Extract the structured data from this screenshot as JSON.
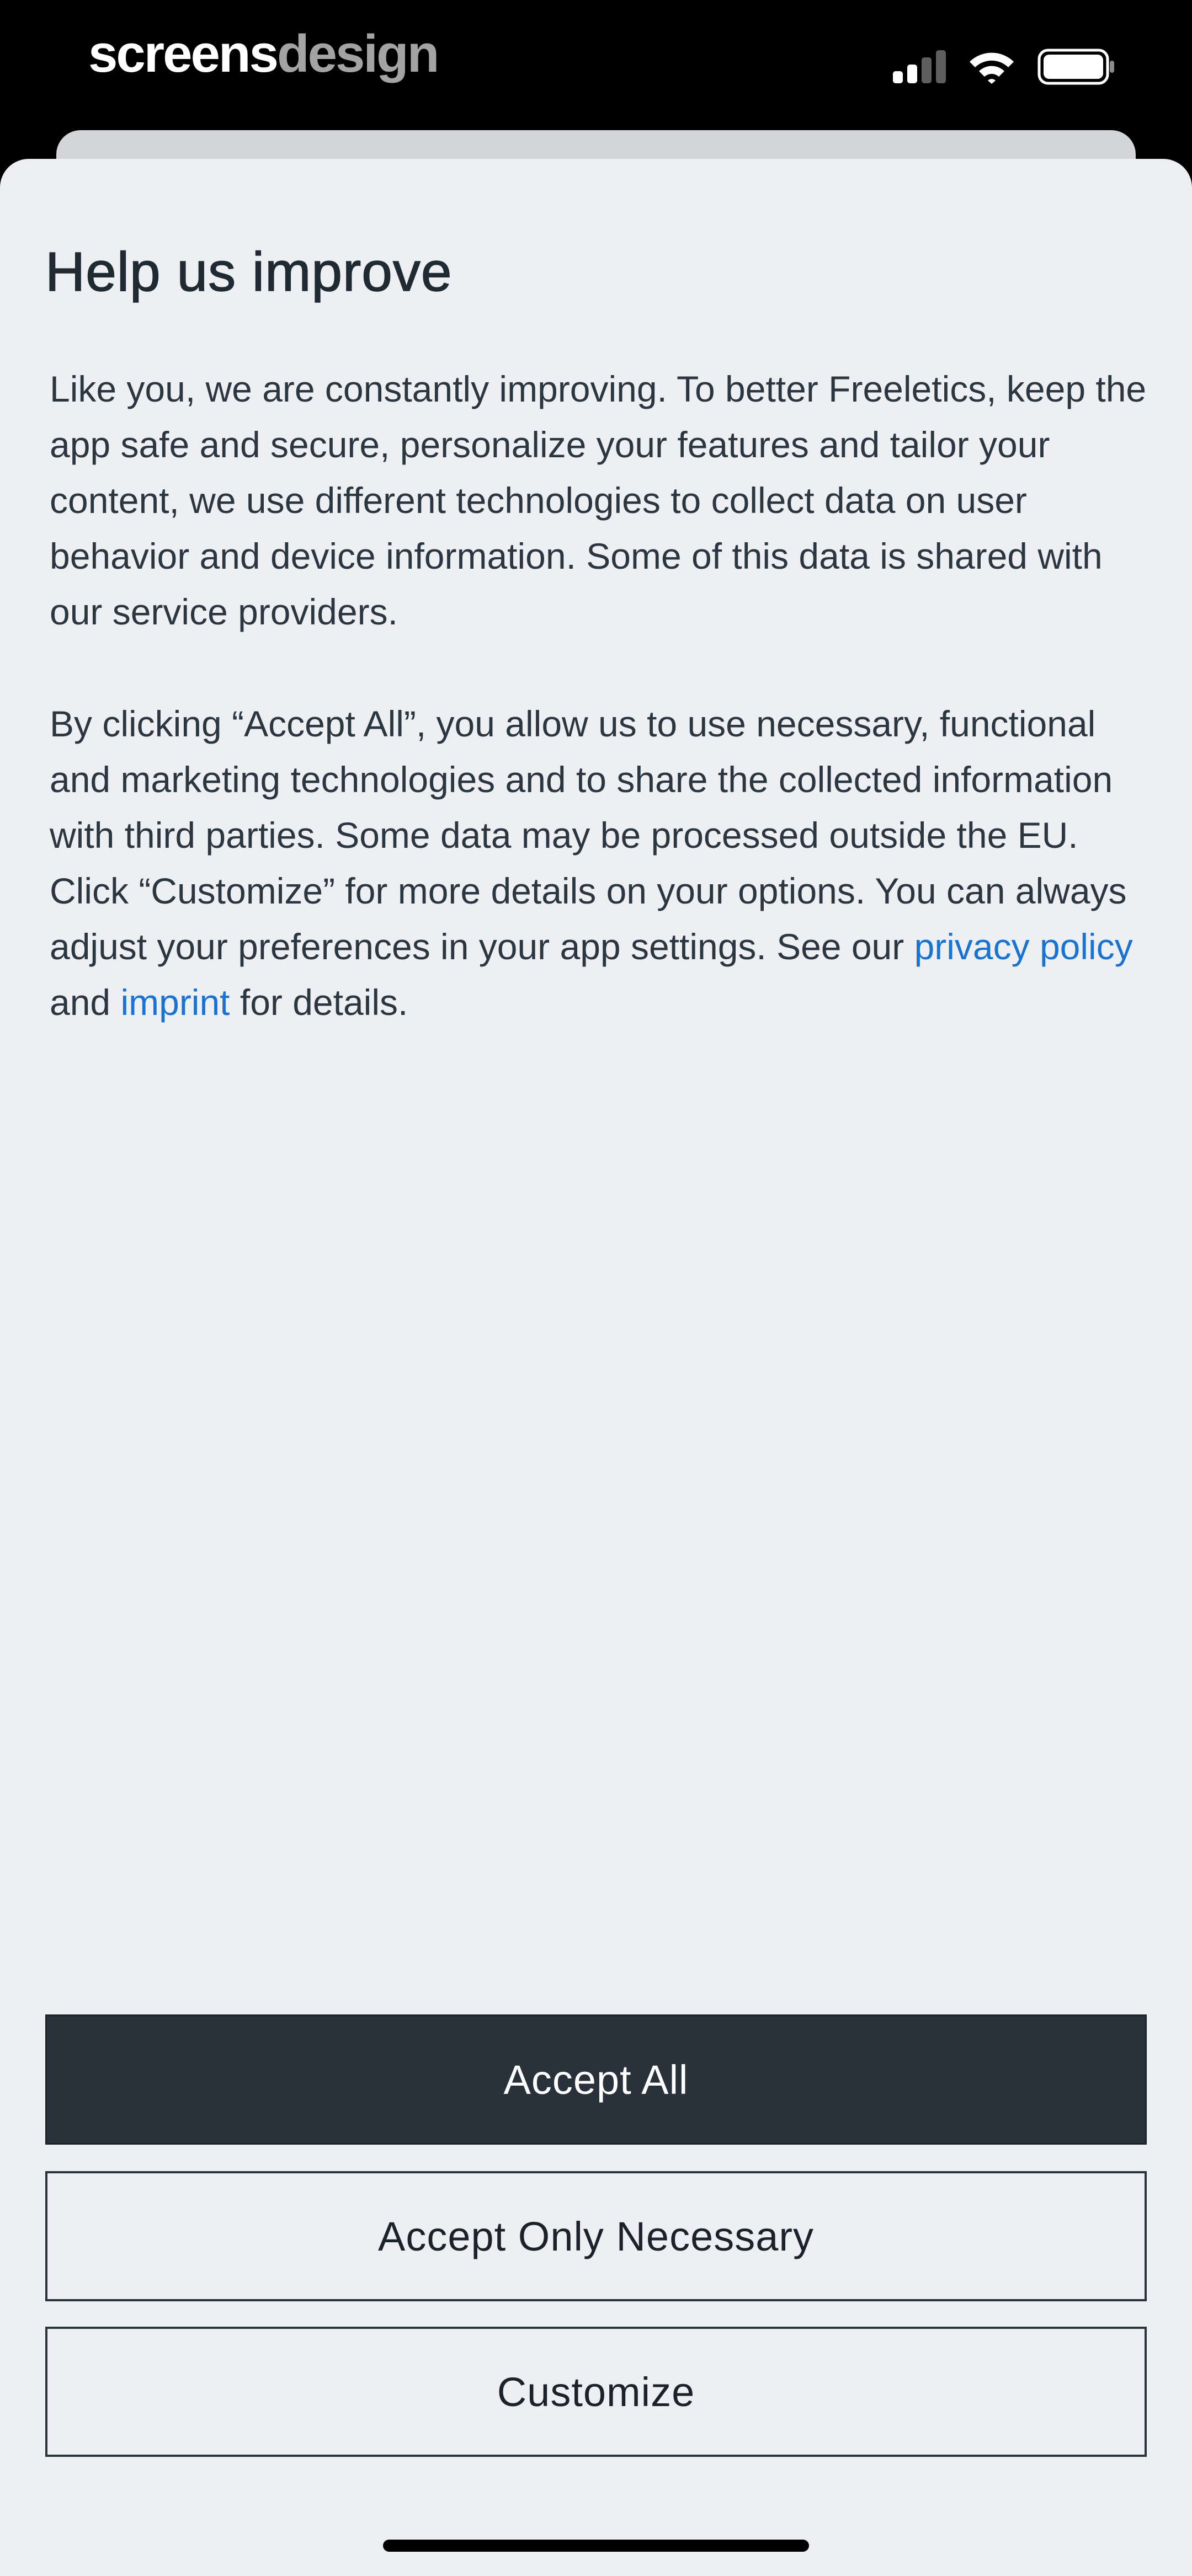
{
  "status_bar": {
    "brand_part1": "screens",
    "brand_part2": "design",
    "icons": [
      "cellular-signal-icon",
      "wifi-icon",
      "battery-icon"
    ]
  },
  "dialog": {
    "title": "Help us improve",
    "paragraph1": "Like you, we are constantly improving. To better Freeletics, keep the app safe and secure, personalize your features and tailor your content, we use different technologies to collect data on user behavior and device information. Some of this data is shared with our service providers.",
    "paragraph2_text": "By clicking “Accept All”, you allow us to use necessary, functional and marketing technologies and to share the collected information with third parties. Some data may be processed outside the EU. Click “Customize” for more details on your options. You can always adjust your preferences in your app settings. See our ",
    "privacy_link": "privacy policy",
    "and_text": " and ",
    "imprint_link": "imprint",
    "tail_text": " for details."
  },
  "buttons": {
    "accept_all": "Accept All",
    "accept_necessary": "Accept Only Necessary",
    "customize": "Customize"
  },
  "colors": {
    "sheet_background": "#edeff3",
    "primary_button": "#29323a",
    "link": "#1a73d1"
  }
}
